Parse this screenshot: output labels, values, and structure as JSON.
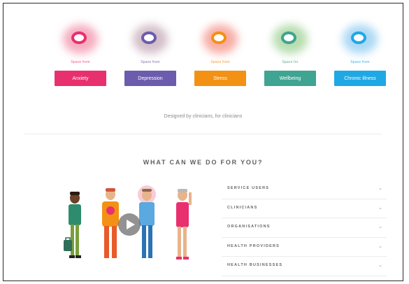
{
  "colors": {
    "pink": "#e8306f",
    "purple": "#6b5cad",
    "orange": "#f39114",
    "teal": "#3fa491",
    "blue": "#1fa8e4",
    "skin": "#e8b48b",
    "hair_dark": "#3a2a20"
  },
  "categories": [
    {
      "caption": "Space from",
      "label": "Anxiety",
      "color": "#e8306f",
      "caption_color": "#e85a86",
      "glow": "#ee6a8c",
      "icon": "pink-swirl-logo-icon"
    },
    {
      "caption": "Space from",
      "label": "Depression",
      "color": "#6b5cad",
      "caption_color": "#7f75b0",
      "glow": "#b08a9d",
      "icon": "purple-swirl-logo-icon"
    },
    {
      "caption": "Space from",
      "label": "Stress",
      "color": "#f39114",
      "caption_color": "#f19a3a",
      "glow": "#f26b5e",
      "icon": "orange-swirl-logo-icon"
    },
    {
      "caption": "Space for",
      "label": "Wellbeing",
      "color": "#3fa491",
      "caption_color": "#5aae9c",
      "glow": "#7cc26f",
      "icon": "green-swirl-logo-icon"
    },
    {
      "caption": "Space from",
      "label": "Chronic illness",
      "color": "#1fa8e4",
      "caption_color": "#3ab1e6",
      "glow": "#67b9ec",
      "icon": "blue-swirl-logo-icon"
    }
  ],
  "tagline": "Designed by clinicians, for clinicians",
  "section_title": "WHAT CAN WE DO FOR YOU?",
  "accordion": [
    {
      "label": "SERVICE USERS",
      "icon": "chevron-down-icon"
    },
    {
      "label": "CLINICIANS",
      "icon": "chevron-down-icon"
    },
    {
      "label": "ORGANISATIONS",
      "icon": "chevron-down-icon"
    },
    {
      "label": "HEALTH PROVIDERS",
      "icon": "chevron-down-icon"
    },
    {
      "label": "HEALTH BUSINESSES",
      "icon": "chevron-down-icon"
    }
  ],
  "chevron_glyph": "⌄",
  "video": {
    "icon": "play-icon"
  }
}
